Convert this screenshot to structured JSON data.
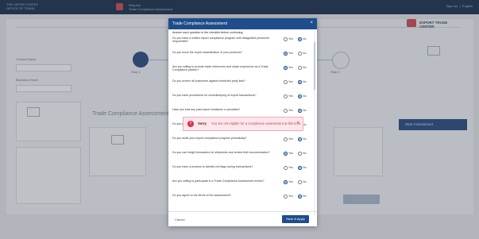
{
  "app": {
    "brand_lines": [
      "THE UNITED STATES",
      "OFFICE OF TRADE"
    ],
    "header_mid": [
      "Request",
      "Trade Compliance Assessment"
    ],
    "header_right": [
      "Sign out",
      "English"
    ],
    "logo_text": "EXPORT TRADE CENTER",
    "step_labels": [
      "Step 1",
      "Step 2"
    ],
    "form_labels": [
      "Contact Name",
      "Business Email"
    ],
    "cards_title": "Trade Compliance Assessment",
    "side_button_label": "Start Assessment"
  },
  "modal": {
    "title": "Trade Compliance Assessment",
    "intro": "Answer each question in the checklist before continuing.",
    "option_yes": "Yes",
    "option_no": "No",
    "questions": [
      {
        "text": "Do you have a written export compliance program with designated personnel responsible?",
        "answer": "no"
      },
      {
        "text": "Do you know the export classification of your products?",
        "answer": "yes"
      },
      {
        "text": "Are you willing to provide trade references and share experience as a Trade Compliance partner?",
        "answer": "yes"
      },
      {
        "text": "Do you screen all customers against restricted party lists?",
        "answer": "no"
      },
      {
        "text": "Do you have procedures for recordkeeping of export transactions?",
        "answer": "no"
      },
      {
        "text": "Have you had any past export violations or penalties?",
        "answer": "no"
      },
      {
        "text": "Do you provide training to employees involved in export activities?",
        "answer": "no"
      },
      {
        "text": "Do you audit your export compliance program periodically?",
        "answer": "no"
      },
      {
        "text": "Do you use freight forwarders for shipments and review their documentation?",
        "answer": "yes"
      },
      {
        "text": "Do you have a process to identify red flags during transactions?",
        "answer": "no"
      },
      {
        "text": "Are you willing to participate in a Trade Compliance Assessment review?",
        "answer": "yes"
      },
      {
        "text": "Do you agree to the terms of the assessment?",
        "answer": "no"
      }
    ],
    "cancel_label": "Cancel",
    "save_label": "Save & Apply"
  },
  "alert": {
    "title": "Sorry",
    "message": "You are not eligible for a compliance assessment at this time."
  }
}
